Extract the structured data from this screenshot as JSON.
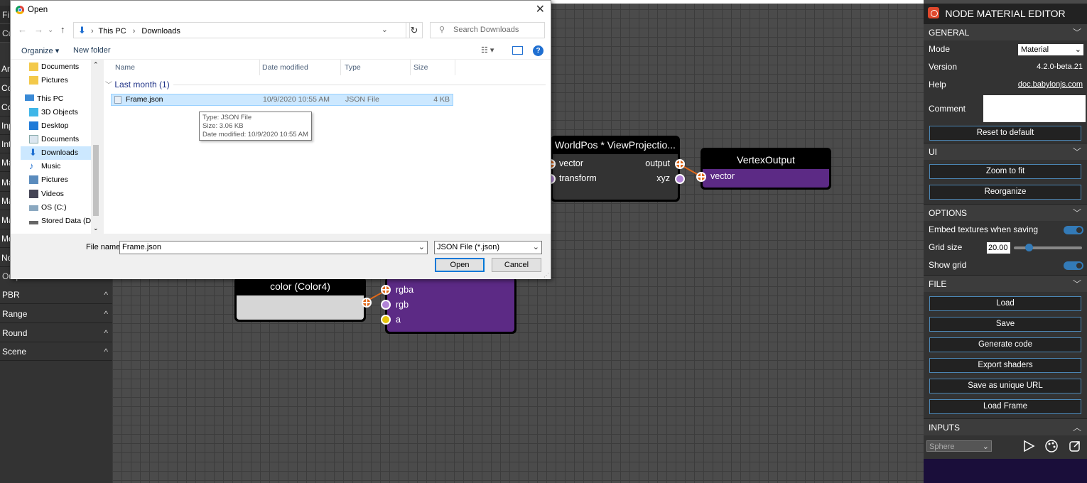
{
  "left_panel": {
    "top_tabs": [
      "Fi",
      "Cu"
    ],
    "partial_items": [
      "Ar",
      "Co",
      "Co",
      "Inp",
      "Int",
      "Ma",
      "Ma",
      "Ma",
      "Ma",
      "Me",
      "No"
    ],
    "output_nodes_label": "Output Nodes",
    "categories": [
      {
        "label": "PBR",
        "chev": "^"
      },
      {
        "label": "Range",
        "chev": "^"
      },
      {
        "label": "Round",
        "chev": "^"
      },
      {
        "label": "Scene",
        "chev": "^"
      }
    ]
  },
  "nodes": {
    "worldpos": {
      "title": "WorldPos * ViewProjectio...",
      "in1": "vector",
      "in2": "transform",
      "out1": "output",
      "out2": "xyz"
    },
    "vertexoutput": {
      "title": "VertexOutput",
      "in1": "vector"
    },
    "color": {
      "title": "color (Color4)"
    },
    "frag": {
      "in1": "rgba",
      "in2": "rgb",
      "in3": "a"
    }
  },
  "right_panel": {
    "title": "NODE MATERIAL EDITOR",
    "general": {
      "header": "GENERAL",
      "mode_label": "Mode",
      "mode_value": "Material",
      "version_label": "Version",
      "version_value": "4.2.0-beta.21",
      "help_label": "Help",
      "help_value": "doc.babylonjs.com",
      "comment_label": "Comment",
      "reset": "Reset to default"
    },
    "ui": {
      "header": "UI",
      "zoom": "Zoom to fit",
      "reorganize": "Reorganize"
    },
    "options": {
      "header": "OPTIONS",
      "embed": "Embed textures when saving",
      "grid_label": "Grid size",
      "grid_value": "20.00",
      "show_grid": "Show grid"
    },
    "file": {
      "header": "FILE",
      "load": "Load",
      "save": "Save",
      "generate": "Generate code",
      "export": "Export shaders",
      "unique": "Save as unique URL",
      "load_frame": "Load Frame"
    },
    "inputs": {
      "header": "INPUTS",
      "mesh_value": "Sphere"
    },
    "accent": "#337ab7"
  },
  "dialog": {
    "title": "Open",
    "breadcrumb": [
      "This PC",
      "Downloads"
    ],
    "search_placeholder": "Search Downloads",
    "organize": "Organize ▾",
    "new_folder": "New folder",
    "tree": [
      "Documents",
      "Pictures",
      "This PC",
      "3D Objects",
      "Desktop",
      "Documents",
      "Downloads",
      "Music",
      "Pictures",
      "Videos",
      "OS (C:)",
      "Stored Data (D:)"
    ],
    "columns": [
      "Name",
      "Date modified",
      "Type",
      "Size"
    ],
    "group": "Last month (1)",
    "file": {
      "name": "Frame.json",
      "date": "10/9/2020 10:55 AM",
      "type": "JSON File",
      "size": "4 KB"
    },
    "tooltip": [
      "Type: JSON File",
      "Size: 3.06 KB",
      "Date modified: 10/9/2020 10:55 AM"
    ],
    "file_name_label": "File name:",
    "file_name_value": "Frame.json",
    "file_type": "JSON File (*.json)",
    "open": "Open",
    "cancel": "Cancel"
  }
}
